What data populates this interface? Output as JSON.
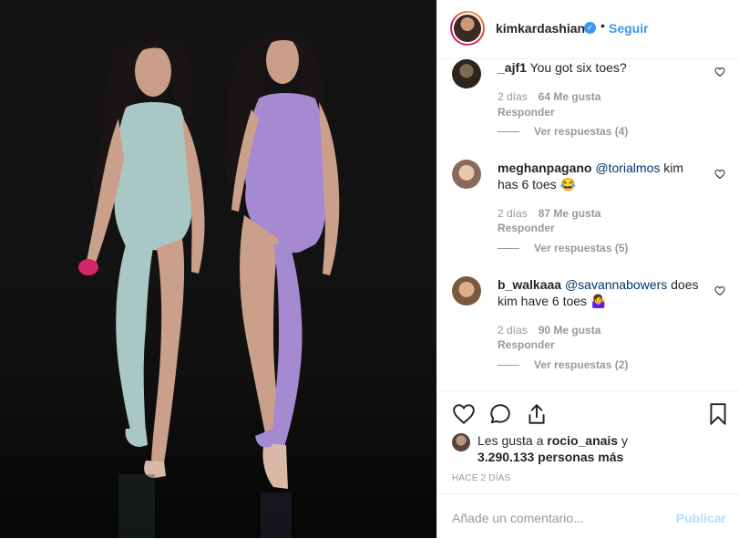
{
  "post": {
    "image_alt": "Photo",
    "author": "kimkardashian",
    "dot": "•",
    "follow_label": "Seguir"
  },
  "comments": [
    {
      "user": "_ajf1",
      "text": "You got six toes?",
      "mention": "",
      "time": "2 días",
      "likes": "64 Me gusta",
      "reply": "Responder",
      "replies": "Ver respuestas (4)"
    },
    {
      "user": "meghanpagano",
      "mention": "@torialmos",
      "text": " kim has 6 toes 😂",
      "time": "2 días",
      "likes": "87 Me gusta",
      "reply": "Responder",
      "replies": "Ver respuestas (5)"
    },
    {
      "user": "b_walkaaa",
      "mention": "@savannabowers",
      "text": " does kim have 6 toes 🤷‍♀️",
      "time": "2 días",
      "likes": "90 Me gusta",
      "reply": "Responder",
      "replies": "Ver respuestas (2)"
    }
  ],
  "likes": {
    "prefix": "Les gusta a ",
    "user": "rocio_anais",
    "suffix": " y",
    "count": "3.290.133 personas más"
  },
  "posted_ago": "HACE 2 DÍAS",
  "comment_input": {
    "placeholder": "Añade un comentario...",
    "publish_label": "Publicar"
  },
  "icons": {
    "verified": "verified-badge-icon",
    "like": "heart-icon",
    "comment": "comment-bubble-icon",
    "share": "share-icon",
    "save": "bookmark-icon"
  },
  "colors": {
    "accent": "#3897f0",
    "publish_disabled": "#b2dffc",
    "muted": "#999999"
  }
}
